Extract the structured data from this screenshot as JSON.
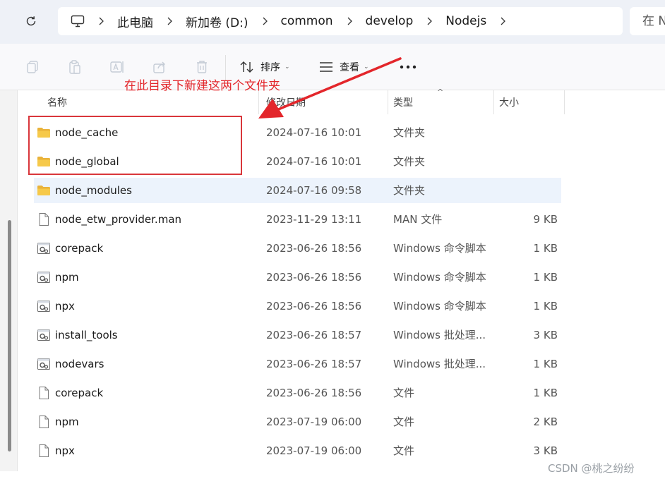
{
  "breadcrumbs": [
    "此电脑",
    "新加卷 (D:)",
    "common",
    "develop",
    "Nodejs"
  ],
  "search": {
    "placeholder": "在 N"
  },
  "toolbar": {
    "sort_label": "排序",
    "view_label": "查看",
    "more_label": "•••"
  },
  "columns": {
    "name": "名称",
    "date": "修改日期",
    "type": "类型",
    "size": "大小"
  },
  "files": [
    {
      "name": "node_cache",
      "date": "2024-07-16 10:01",
      "type": "文件夹",
      "size": "",
      "icon": "folder-icon"
    },
    {
      "name": "node_global",
      "date": "2024-07-16 10:01",
      "type": "文件夹",
      "size": "",
      "icon": "folder-icon"
    },
    {
      "name": "node_modules",
      "date": "2024-07-16 09:58",
      "type": "文件夹",
      "size": "",
      "icon": "folder-icon"
    },
    {
      "name": "node_etw_provider.man",
      "date": "2023-11-29 13:11",
      "type": "MAN 文件",
      "size": "9 KB",
      "icon": "file-icon"
    },
    {
      "name": "corepack",
      "date": "2023-06-26 18:56",
      "type": "Windows 命令脚本",
      "size": "1 KB",
      "icon": "script-icon"
    },
    {
      "name": "npm",
      "date": "2023-06-26 18:56",
      "type": "Windows 命令脚本",
      "size": "1 KB",
      "icon": "script-icon"
    },
    {
      "name": "npx",
      "date": "2023-06-26 18:56",
      "type": "Windows 命令脚本",
      "size": "1 KB",
      "icon": "script-icon"
    },
    {
      "name": "install_tools",
      "date": "2023-06-26 18:57",
      "type": "Windows 批处理...",
      "size": "3 KB",
      "icon": "script-icon"
    },
    {
      "name": "nodevars",
      "date": "2023-06-26 18:57",
      "type": "Windows 批处理...",
      "size": "1 KB",
      "icon": "script-icon"
    },
    {
      "name": "corepack",
      "date": "2023-06-26 18:56",
      "type": "文件",
      "size": "1 KB",
      "icon": "file-icon"
    },
    {
      "name": "npm",
      "date": "2023-07-19 06:00",
      "type": "文件",
      "size": "2 KB",
      "icon": "file-icon"
    },
    {
      "name": "npx",
      "date": "2023-07-19 06:00",
      "type": "文件",
      "size": "3 KB",
      "icon": "file-icon"
    }
  ],
  "selected_row": 2,
  "annotation": {
    "text": "在此目录下新建这两个文件夹",
    "color": "#e3262b"
  },
  "watermark": "CSDN @桃之纷纷",
  "colors": {
    "folder": "#f6c94a",
    "accent": "#0067c0",
    "selection": "#ecf3fc"
  }
}
